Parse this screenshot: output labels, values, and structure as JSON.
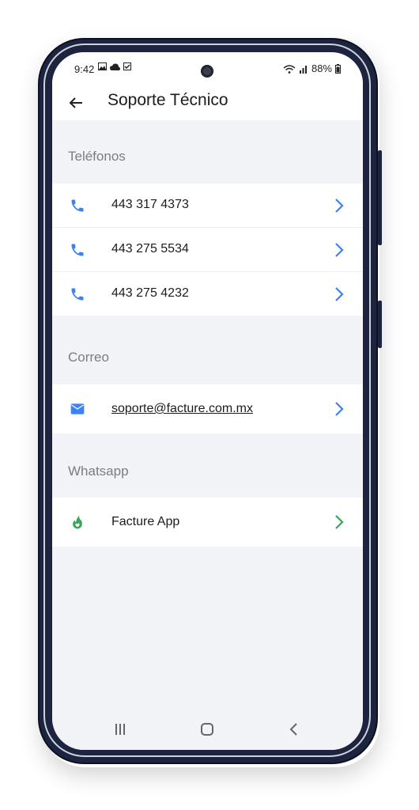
{
  "status": {
    "time": "9:42",
    "battery": "88%"
  },
  "appbar": {
    "title": "Soporte Técnico"
  },
  "sections": {
    "phones": {
      "label": "Teléfonos",
      "items": [
        "443 317 4373",
        "443 275 5534",
        "443 275 4232"
      ]
    },
    "email": {
      "label": "Correo",
      "address": "soporte@facture.com.mx"
    },
    "whatsapp": {
      "label": "Whatsapp",
      "name": "Facture App"
    }
  },
  "colors": {
    "accent_blue": "#3b82f6",
    "accent_green": "#34a853"
  },
  "icons": [
    "back-arrow-icon",
    "phone-icon",
    "mail-icon",
    "whatsapp-flame-icon",
    "chevron-right-icon",
    "recents-icon",
    "home-icon",
    "back-nav-icon"
  ]
}
